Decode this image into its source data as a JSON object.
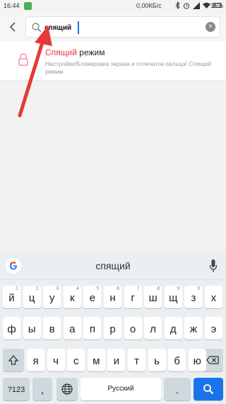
{
  "status_bar": {
    "time": "16:44",
    "net_speed": "0,00КБ/с",
    "battery": "15%"
  },
  "search": {
    "query": "спящий",
    "back_label": "‹",
    "clear_label": "×"
  },
  "result": {
    "title_highlight": "Спящий",
    "title_rest": " режим",
    "path": "Настройки/Блокировка экрана и отпечаток пальца/ Спящий режим"
  },
  "keyboard": {
    "suggestion": "спящий",
    "row1": [
      {
        "key": "й",
        "hint": "1"
      },
      {
        "key": "ц",
        "hint": "2"
      },
      {
        "key": "у",
        "hint": "3"
      },
      {
        "key": "к",
        "hint": "4"
      },
      {
        "key": "е",
        "hint": "5"
      },
      {
        "key": "н",
        "hint": "6"
      },
      {
        "key": "г",
        "hint": "7"
      },
      {
        "key": "ш",
        "hint": "8"
      },
      {
        "key": "щ",
        "hint": "9"
      },
      {
        "key": "з",
        "hint": "0"
      },
      {
        "key": "х",
        "hint": ""
      }
    ],
    "row2": [
      "ф",
      "ы",
      "в",
      "а",
      "п",
      "р",
      "о",
      "л",
      "д",
      "ж",
      "э"
    ],
    "row3": [
      "я",
      "ч",
      "с",
      "м",
      "и",
      "т",
      "ь",
      "б",
      "ю"
    ],
    "mode_key": "?123",
    "space_label": "Русский",
    "period": ".",
    "comma": ","
  },
  "colors": {
    "accent": "#1a73e8",
    "highlight": "#e53935",
    "arrow": "#e53935"
  },
  "icons": [
    "back-icon",
    "search-icon",
    "clear-icon",
    "lock-icon",
    "google-icon",
    "mic-icon",
    "shift-icon",
    "backspace-icon",
    "globe-icon",
    "search-action-icon"
  ]
}
